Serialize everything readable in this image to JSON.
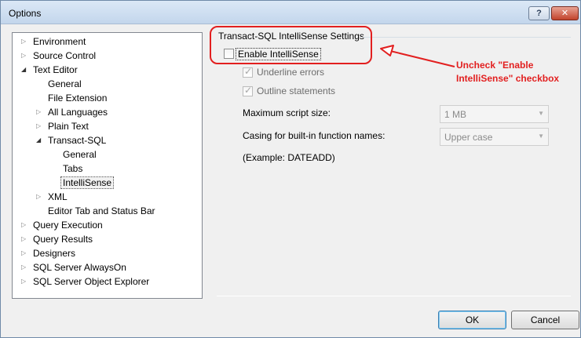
{
  "window": {
    "title": "Options",
    "help_label": "?",
    "close_label": "✕"
  },
  "tree": {
    "items": [
      {
        "label": "Environment",
        "expander": "▷"
      },
      {
        "label": "Source Control",
        "expander": "▷"
      },
      {
        "label": "Text Editor",
        "expander": "◢"
      },
      {
        "label": "General",
        "expander": ""
      },
      {
        "label": "File Extension",
        "expander": ""
      },
      {
        "label": "All Languages",
        "expander": "▷"
      },
      {
        "label": "Plain Text",
        "expander": "▷"
      },
      {
        "label": "Transact-SQL",
        "expander": "◢"
      },
      {
        "label": "General",
        "expander": ""
      },
      {
        "label": "Tabs",
        "expander": ""
      },
      {
        "label": "IntelliSense",
        "expander": "",
        "selected": true
      },
      {
        "label": "XML",
        "expander": "▷"
      },
      {
        "label": "Editor Tab and Status Bar",
        "expander": ""
      },
      {
        "label": "Query Execution",
        "expander": "▷"
      },
      {
        "label": "Query Results",
        "expander": "▷"
      },
      {
        "label": "Designers",
        "expander": "▷"
      },
      {
        "label": "SQL Server AlwaysOn",
        "expander": "▷"
      },
      {
        "label": "SQL Server Object Explorer",
        "expander": "▷"
      }
    ]
  },
  "settings": {
    "group_title": "Transact-SQL IntelliSense Settings",
    "enable_intellisense": {
      "label": "Enable IntelliSense",
      "checked": false
    },
    "underline_errors": {
      "label": "Underline errors",
      "checked": true,
      "enabled": false
    },
    "outline_statements": {
      "label": "Outline statements",
      "checked": true,
      "enabled": false
    },
    "max_script_size": {
      "label": "Maximum script size:",
      "value": "1 MB"
    },
    "casing": {
      "label": "Casing for built-in function names:",
      "value": "Upper case"
    },
    "example": "(Example: DATEADD)",
    "dropdown_glyph": "▼",
    "check_glyph": "✓"
  },
  "buttons": {
    "ok": "OK",
    "cancel": "Cancel"
  },
  "annotation": {
    "line1": "Uncheck \"Enable",
    "line2": "IntelliSense\" checkbox",
    "color": "#e21f1f"
  }
}
